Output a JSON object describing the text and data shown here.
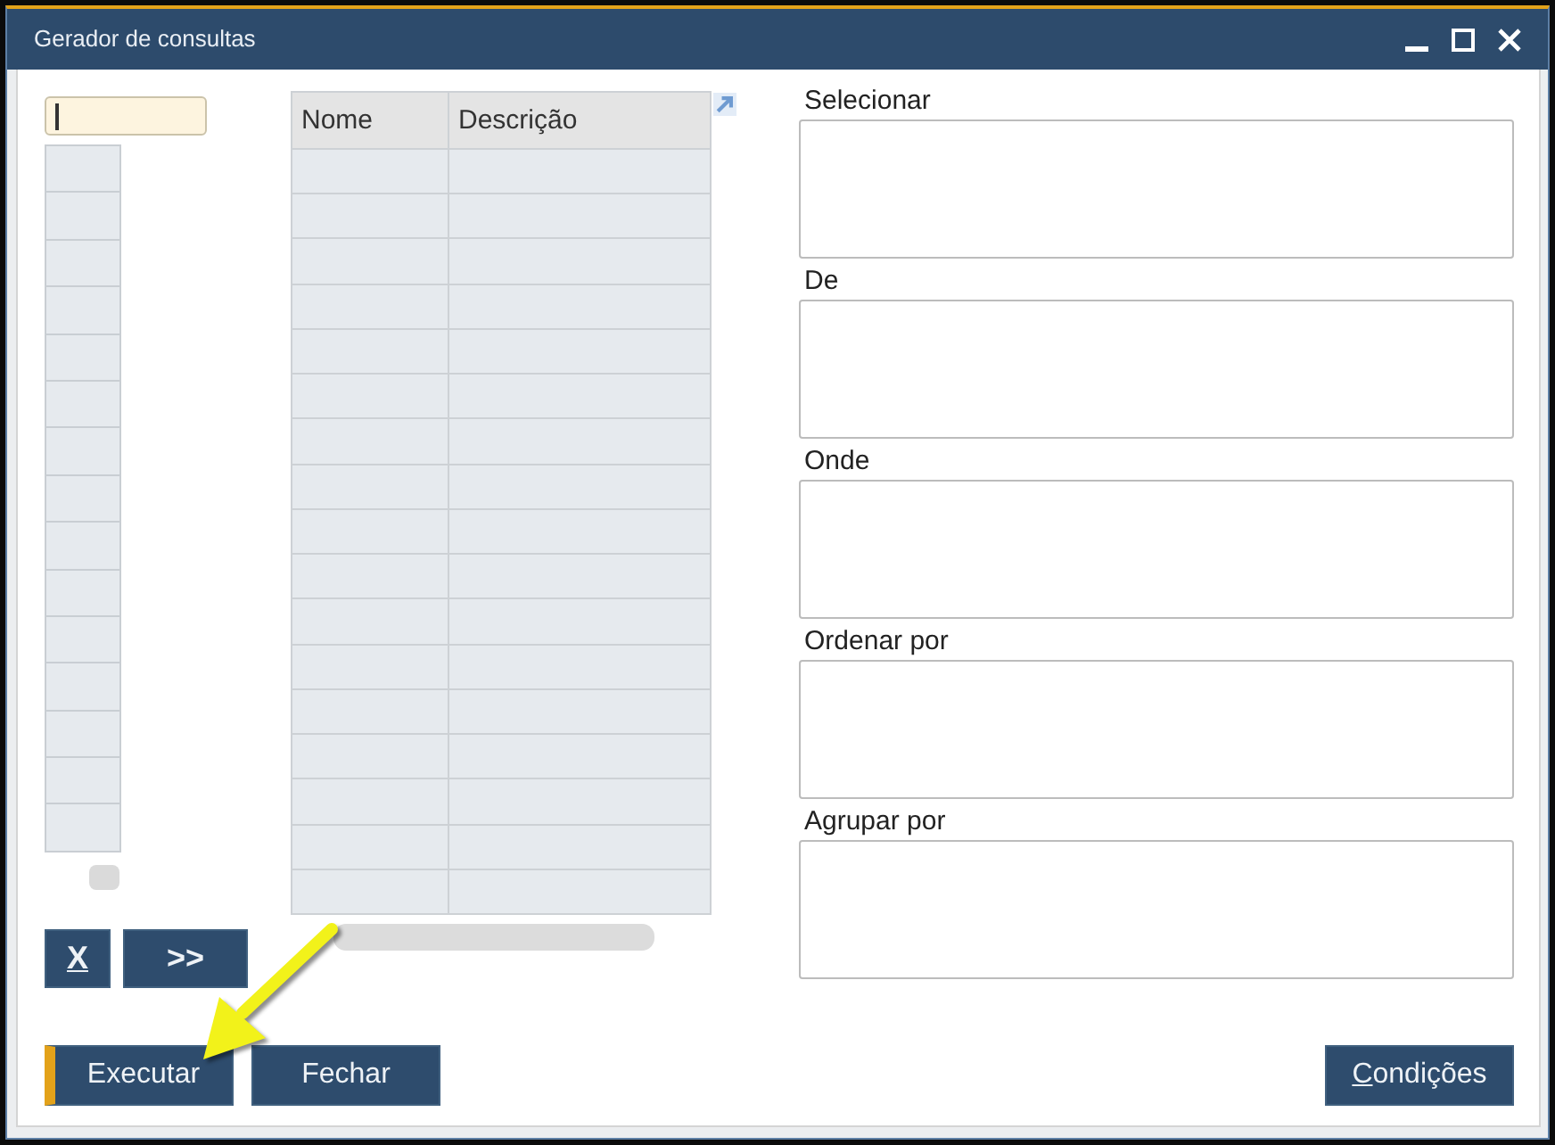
{
  "window": {
    "title": "Gerador de consultas"
  },
  "entry_field": {
    "focused": true
  },
  "table": {
    "columns": [
      "Nome",
      "Descrição"
    ]
  },
  "tool_buttons": [
    {
      "label": "X",
      "bold": true,
      "underlined": true
    },
    {
      "label": ">>",
      "bold": true,
      "underlined": false
    }
  ],
  "clauses": [
    {
      "label": "Selecionar"
    },
    {
      "label": "De"
    },
    {
      "label": "Onde"
    },
    {
      "label": "Ordenar por"
    },
    {
      "label": "Agrupar por"
    }
  ],
  "footer": {
    "left": [
      {
        "label": "Executar",
        "default": true,
        "first_letter_underlined": false
      },
      {
        "label": "Fechar",
        "default": false,
        "first_letter_underlined": false
      }
    ],
    "right": [
      {
        "label": "Condições",
        "default": false,
        "first_letter_underlined": true
      }
    ]
  }
}
